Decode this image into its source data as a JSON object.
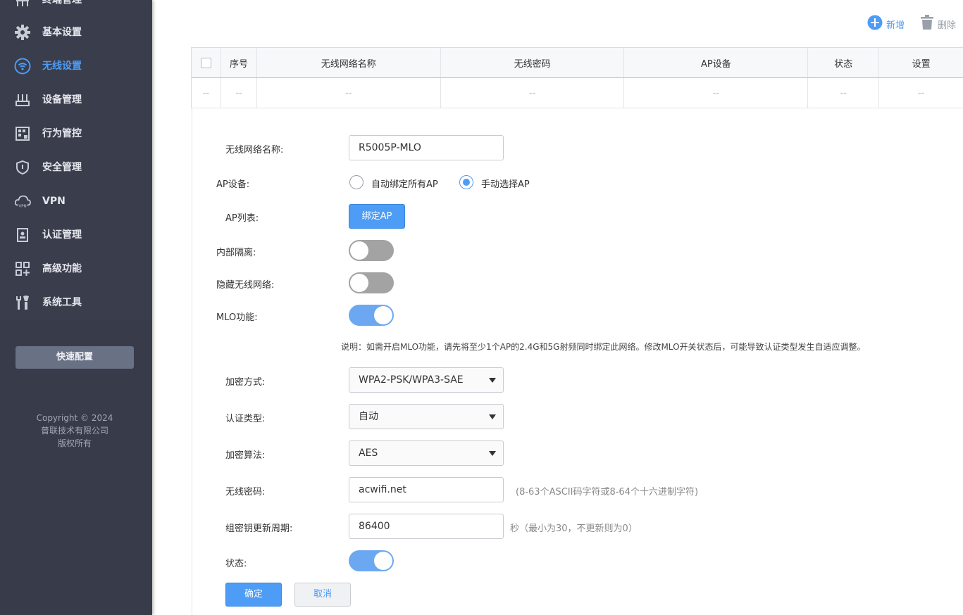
{
  "sidebar": {
    "items": [
      {
        "label": "终端管理",
        "icon": "terminal-icon"
      },
      {
        "label": "基本设置",
        "icon": "gear-icon"
      },
      {
        "label": "无线设置",
        "icon": "wifi-icon"
      },
      {
        "label": "设备管理",
        "icon": "device-icon"
      },
      {
        "label": "行为管控",
        "icon": "behavior-icon"
      },
      {
        "label": "安全管理",
        "icon": "shield-icon"
      },
      {
        "label": "VPN",
        "icon": "vpn-cloud-icon"
      },
      {
        "label": "认证管理",
        "icon": "badge-icon"
      },
      {
        "label": "高级功能",
        "icon": "apps-icon"
      },
      {
        "label": "系统工具",
        "icon": "tools-icon"
      }
    ],
    "active": "无线设置",
    "quick_config": "快速配置",
    "copyright": [
      "Copyright © 2024",
      "普联技术有限公司",
      "版权所有"
    ]
  },
  "toolbar": {
    "add_label": "新增",
    "delete_label": "删除"
  },
  "table": {
    "headers": [
      "序号",
      "无线网络名称",
      "无线密码",
      "AP设备",
      "状态",
      "设置"
    ],
    "rows": [
      [
        "--",
        "--",
        "--",
        "--",
        "--",
        "--",
        "--"
      ]
    ]
  },
  "form": {
    "ssid": {
      "label": "无线网络名称:",
      "value": "R5005P-MLO"
    },
    "ap_device": {
      "label": "AP设备:",
      "options": [
        "自动绑定所有AP",
        "手动选择AP"
      ],
      "selected": "手动选择AP"
    },
    "ap_list": {
      "label": "AP列表:",
      "button": "绑定AP"
    },
    "isolation": {
      "label": "内部隔离:",
      "on": false
    },
    "hide_ssid": {
      "label": "隐藏无线网络:",
      "on": false
    },
    "mlo": {
      "label": "MLO功能:",
      "on": true
    },
    "mlo_note": "说明：如需开启MLO功能，请先将至少1个AP的2.4G和5G射频同时绑定此网络。修改MLO开关状态后，可能导致认证类型发生自适应调整。",
    "encryption": {
      "label": "加密方式:",
      "value": "WPA2-PSK/WPA3-SAE"
    },
    "auth_type": {
      "label": "认证类型:",
      "value": "自动"
    },
    "algorithm": {
      "label": "加密算法:",
      "value": "AES"
    },
    "password": {
      "label": "无线密码:",
      "value": "acwifi.net",
      "hint": "(8-63个ASCII码字符或8-64个十六进制字符)"
    },
    "rekey": {
      "label": "组密钥更新周期:",
      "value": "86400",
      "hint": "秒（最小为30，不更新则为0）"
    },
    "status": {
      "label": "状态:",
      "on": true
    },
    "ok_button": "确定",
    "cancel_button": "取消"
  },
  "colors": {
    "accent": "#4d9cf5",
    "sidebar_bg": "#3a3d4c",
    "toggle_on": "#6ca8f2",
    "toggle_off": "#a3a3a3"
  }
}
